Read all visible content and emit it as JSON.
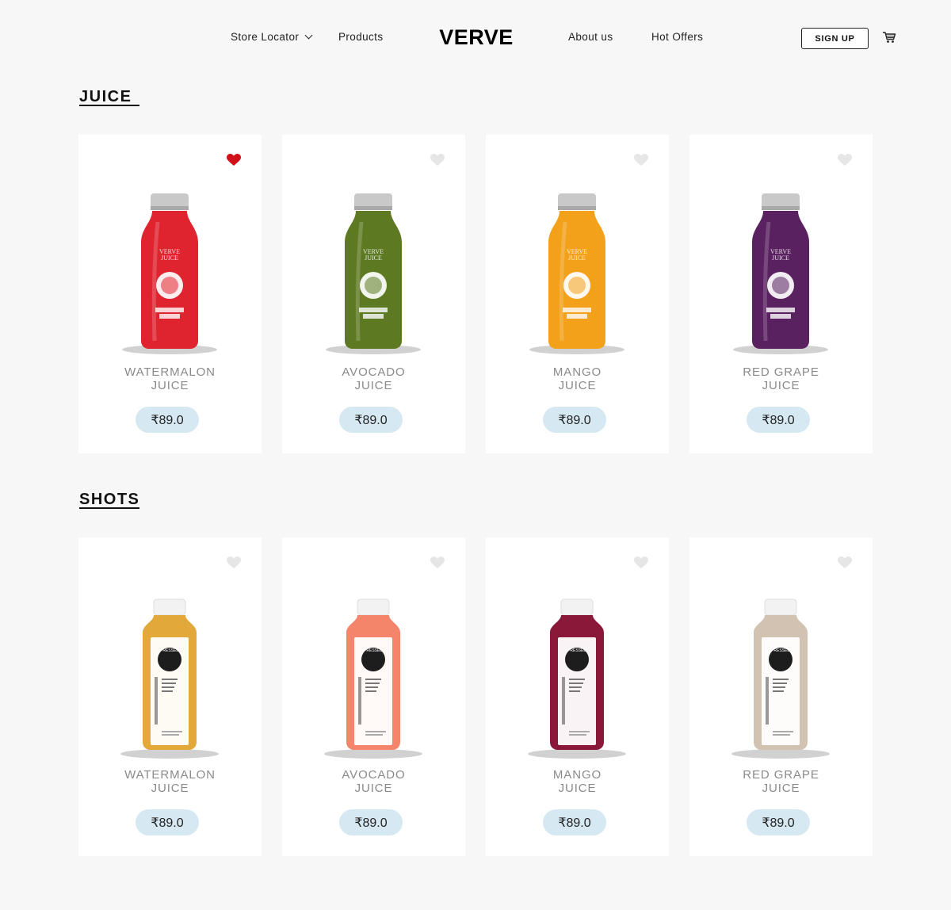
{
  "nav": {
    "store_locator": "Store Locator",
    "products": "Products",
    "logo": "VERVE",
    "about": "About us",
    "hot_offers": "Hot Offers",
    "signup": "SIGN UP"
  },
  "colors": {
    "accent_heart": "#d0111b",
    "price_pill": "#d6e8f2",
    "background": "#f7f7f7"
  },
  "sections": [
    {
      "title": "JUICE",
      "products": [
        {
          "name_line1": "WATERMALON",
          "name_line2": "JUICE",
          "price": "₹89.0",
          "favorited": true,
          "bottle_color": "#e0242f",
          "bottle_style": "verve",
          "bottle_label": "VERVE JUICE"
        },
        {
          "name_line1": "AVOCADO",
          "name_line2": "JUICE",
          "price": "₹89.0",
          "favorited": false,
          "bottle_color": "#5d7a23",
          "bottle_style": "verve",
          "bottle_label": "VERVE JUICE"
        },
        {
          "name_line1": "MANGO",
          "name_line2": "JUICE",
          "price": "₹89.0",
          "favorited": false,
          "bottle_color": "#f3a11b",
          "bottle_style": "verve",
          "bottle_label": "VERVE JUICE"
        },
        {
          "name_line1": "RED GRAPE",
          "name_line2": "JUICE",
          "price": "₹89.0",
          "favorited": false,
          "bottle_color": "#5a2160",
          "bottle_style": "verve",
          "bottle_label": "VERVE JUICE"
        }
      ]
    },
    {
      "title": "SHOTS",
      "products": [
        {
          "name_line1": "WATERMALON",
          "name_line2": "JUICE",
          "price": "₹89.0",
          "favorited": false,
          "bottle_color": "#e2a93a",
          "bottle_style": "pressed",
          "bottle_label": "PRESSED"
        },
        {
          "name_line1": "AVOCADO",
          "name_line2": "JUICE",
          "price": "₹89.0",
          "favorited": false,
          "bottle_color": "#f4856b",
          "bottle_style": "pressed",
          "bottle_label": "PRESSED"
        },
        {
          "name_line1": "MANGO",
          "name_line2": "JUICE",
          "price": "₹89.0",
          "favorited": false,
          "bottle_color": "#8a1838",
          "bottle_style": "pressed",
          "bottle_label": "PRESSED"
        },
        {
          "name_line1": "RED GRAPE",
          "name_line2": "JUICE",
          "price": "₹89.0",
          "favorited": false,
          "bottle_color": "#d2c2b2",
          "bottle_style": "pressed",
          "bottle_label": "PRESSED"
        }
      ]
    }
  ]
}
